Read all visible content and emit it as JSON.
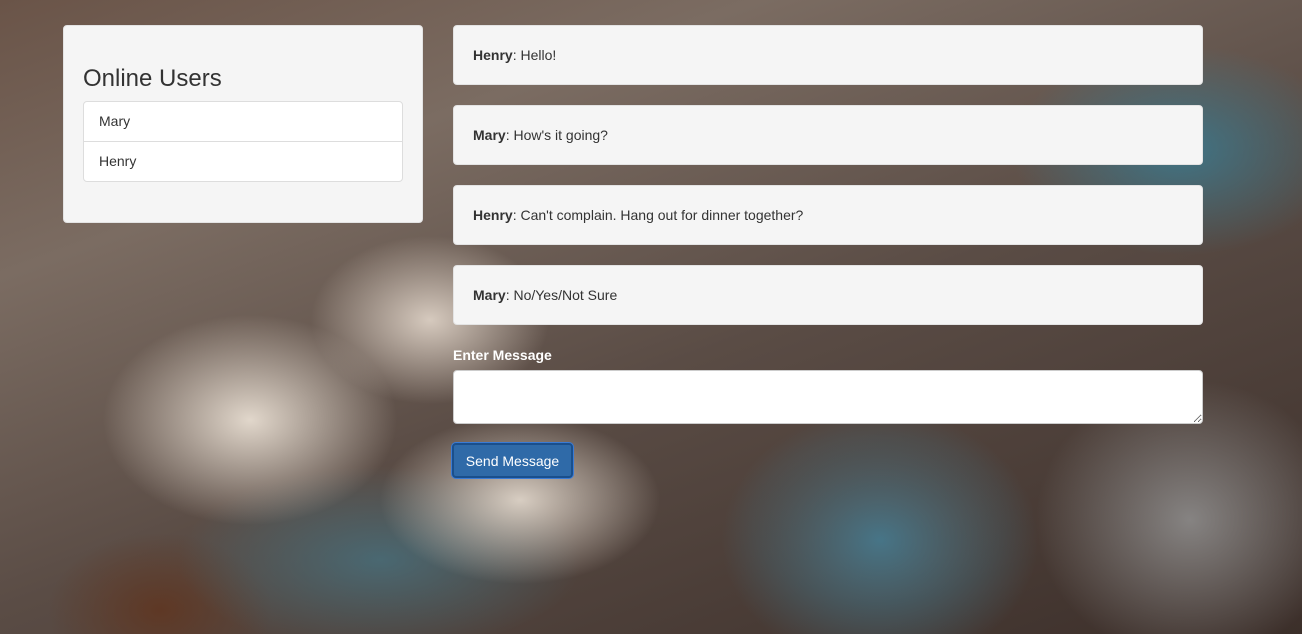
{
  "sidebar": {
    "title": "Online Users",
    "users": [
      "Mary",
      "Henry"
    ]
  },
  "messages": [
    {
      "sender": "Henry",
      "text": ": Hello!"
    },
    {
      "sender": "Mary",
      "text": ": How's it going?"
    },
    {
      "sender": "Henry",
      "text": ": Can't complain. Hang out for dinner together?"
    },
    {
      "sender": "Mary",
      "text": ": No/Yes/Not Sure"
    }
  ],
  "composer": {
    "label": "Enter Message",
    "value": "",
    "send_label": "Send Message"
  },
  "colors": {
    "panel_bg": "#f5f5f5",
    "button_bg": "#2f6aa8",
    "label_text": "#ffffff"
  }
}
